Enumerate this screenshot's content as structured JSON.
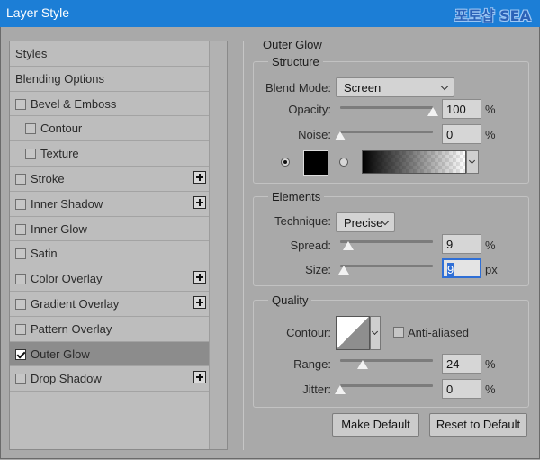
{
  "window": {
    "title": "Layer Style",
    "watermark": "포토샵 SEA"
  },
  "left_panel": {
    "items": [
      {
        "label": "Styles",
        "checkbox": false,
        "checked": false,
        "plus": false,
        "indent": 0
      },
      {
        "label": "Blending Options",
        "checkbox": false,
        "checked": false,
        "plus": false,
        "indent": 0
      },
      {
        "label": "Bevel & Emboss",
        "checkbox": true,
        "checked": false,
        "plus": false,
        "indent": 0
      },
      {
        "label": "Contour",
        "checkbox": true,
        "checked": false,
        "plus": false,
        "indent": 1
      },
      {
        "label": "Texture",
        "checkbox": true,
        "checked": false,
        "plus": false,
        "indent": 1
      },
      {
        "label": "Stroke",
        "checkbox": true,
        "checked": false,
        "plus": true,
        "indent": 0
      },
      {
        "label": "Inner Shadow",
        "checkbox": true,
        "checked": false,
        "plus": true,
        "indent": 0
      },
      {
        "label": "Inner Glow",
        "checkbox": true,
        "checked": false,
        "plus": false,
        "indent": 0
      },
      {
        "label": "Satin",
        "checkbox": true,
        "checked": false,
        "plus": false,
        "indent": 0
      },
      {
        "label": "Color Overlay",
        "checkbox": true,
        "checked": false,
        "plus": true,
        "indent": 0
      },
      {
        "label": "Gradient Overlay",
        "checkbox": true,
        "checked": false,
        "plus": true,
        "indent": 0
      },
      {
        "label": "Pattern Overlay",
        "checkbox": true,
        "checked": false,
        "plus": false,
        "indent": 0
      },
      {
        "label": "Outer Glow",
        "checkbox": true,
        "checked": true,
        "plus": false,
        "indent": 0,
        "selected": true
      },
      {
        "label": "Drop Shadow",
        "checkbox": true,
        "checked": false,
        "plus": true,
        "indent": 0
      }
    ]
  },
  "outer_glow": {
    "title": "Outer Glow",
    "structure": {
      "title": "Structure",
      "blend_mode_label": "Blend Mode:",
      "blend_mode_value": "Screen",
      "opacity_label": "Opacity:",
      "opacity_value": "100",
      "opacity_level": 1.0,
      "opacity_unit": "%",
      "noise_label": "Noise:",
      "noise_value": "0",
      "noise_level": 0.0,
      "noise_unit": "%",
      "color_mode": "solid",
      "color": "#000000"
    },
    "elements": {
      "title": "Elements",
      "technique_label": "Technique:",
      "technique_value": "Precise",
      "spread_label": "Spread:",
      "spread_value": "9",
      "spread_level": 0.09,
      "spread_unit": "%",
      "size_label": "Size:",
      "size_value": "9",
      "size_level": 0.04,
      "size_unit": "px"
    },
    "quality": {
      "title": "Quality",
      "contour_label": "Contour:",
      "anti_aliased_label": "Anti-aliased",
      "anti_aliased": false,
      "range_label": "Range:",
      "range_value": "24",
      "range_level": 0.24,
      "range_unit": "%",
      "jitter_label": "Jitter:",
      "jitter_value": "0",
      "jitter_level": 0.0,
      "jitter_unit": "%"
    },
    "buttons": {
      "make_default": "Make Default",
      "reset_default": "Reset to Default"
    }
  }
}
